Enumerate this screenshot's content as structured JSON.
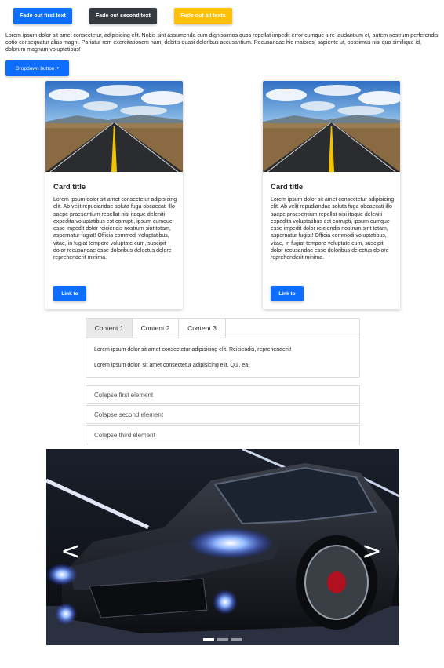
{
  "buttons": {
    "fade_first": "Fade out first text",
    "fade_second": "Fade out second text",
    "fade_all": "Fade out all texts"
  },
  "paragraph": "Lorem ipsum dolor sit amet consectetur, adipisicing elit. Nobis sint assumenda cum dignissimos quos repellat impedit error cumque iure laudantium et, autem nostrum perferendis optio consequatur alias magni. Pariatur rem exercitationem nam, debitis quasi doloribus accusantium. Recusandae hic maiores, sapiente ut, possimus nisi quo similique id, dolorum magnam voluptatibus!",
  "dropdown": {
    "label": "Dropdown button",
    "caret": "▾"
  },
  "cards": [
    {
      "title": "Card title",
      "text": "Lorem ipsum dolor sit amet consectetur adipisicing elit. Ab velit repudiandae soluta fuga obcaecati illo saepe praesentium repellat nisi itaque deleniti expedita voluptatibus est corrupti, ipsum cumque esse impedit dolor reiciendis nostrum sint totam, aspernatur fugiat! Officia commodi voluptatibus, vitae, in fugiat tempore voluptate cum, suscipit dolor recusandae esse doloribus delectus dolore reprehenderit minima.",
      "link": "Link to"
    },
    {
      "title": "Card title",
      "text": "Lorem ipsum dolor sit amet consectetur adipisicing elit. Ab velit repudiandae soluta fuga obcaecati illo saepe praesentium repellat nisi itaque deleniti expedita voluptatibus est corrupti, ipsum cumque esse impedit dolor reiciendis nostrum sint totam, aspernatur fugiat! Officia commodi voluptatibus, vitae, in fugiat tempore voluptate cum, suscipit dolor recusandae esse doloribus delectus dolore reprehenderit minima.",
      "link": "Link to"
    }
  ],
  "tabs": {
    "items": [
      "Content 1",
      "Content 2",
      "Content 3"
    ],
    "active": "Content 1",
    "line1": "Lorem ipsum dolor sit amet consectetur adipisicing elit. Reiciendis, reprehenderit!",
    "line2": "Lorem ipsum dolor, sit amet consectetur adipisicing elit. Qui, ea."
  },
  "collapse": [
    "Colapse first element",
    "Colapse second element",
    "Colapse third element"
  ],
  "carousel": {
    "prev": "<",
    "next": ">",
    "indicator_count": 3,
    "active_index": 0
  },
  "colors": {
    "primary": "#0d6efd",
    "dark": "#343a40",
    "warning": "#ffc107"
  },
  "icons": [
    "caret-down-icon",
    "chevron-left-icon",
    "chevron-right-icon"
  ]
}
